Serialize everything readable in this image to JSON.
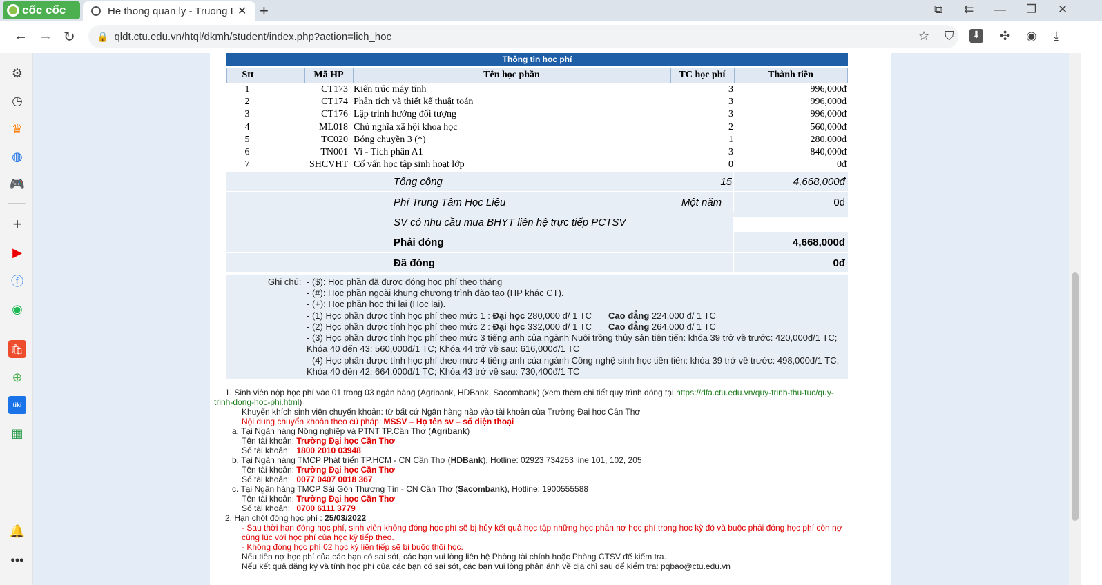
{
  "browser": {
    "logo_text": "cốc cốc",
    "tab_title": "He thong quan ly - Truong D",
    "url": "qldt.ctu.edu.vn/htql/dkmh/student/index.php?action=lich_hoc"
  },
  "fee": {
    "title": "Thông tin học phí",
    "headers": {
      "stt": "Stt",
      "code": "Mã HP",
      "name": "Tên học phần",
      "credits": "TC học phí",
      "amount": "Thành tiền"
    },
    "rows": [
      {
        "stt": "1",
        "code": "CT173",
        "name": "Kiến trúc máy tính",
        "credits": "3",
        "amount": "996,000đ"
      },
      {
        "stt": "2",
        "code": "CT174",
        "name": "Phân tích và thiết kế thuật toán",
        "credits": "3",
        "amount": "996,000đ"
      },
      {
        "stt": "3",
        "code": "CT176",
        "name": "Lập trình hướng đối tượng",
        "credits": "3",
        "amount": "996,000đ"
      },
      {
        "stt": "4",
        "code": "ML018",
        "name": "Chủ nghĩa xã hội khoa học",
        "credits": "2",
        "amount": "560,000đ"
      },
      {
        "stt": "5",
        "code": "TC020",
        "name": "Bóng chuyền 3 (*)",
        "credits": "1",
        "amount": "280,000đ"
      },
      {
        "stt": "6",
        "code": "TN001",
        "name": "Vi - Tích phân A1",
        "credits": "3",
        "amount": "840,000đ"
      },
      {
        "stt": "7",
        "code": "SHCVHT",
        "name": "Cố vấn học tập sinh hoạt lớp",
        "credits": "0",
        "amount": "0đ"
      }
    ],
    "total_label": "Tổng cộng",
    "total_credits": "15",
    "total_amount": "4,668,000đ",
    "material_label": "Phí Trung Tâm Học Liệu",
    "material_period": "Một năm",
    "material_amount": "0đ",
    "insurance_label": "SV có nhu cầu mua BHYT liên hệ trực tiếp PCTSV",
    "must_pay_label": "Phải đóng",
    "must_pay_amount": "4,668,000đ",
    "paid_label": "Đã đóng",
    "paid_amount": "0đ"
  },
  "notes": {
    "label": "Ghi chú:",
    "n1": "- ($): Học phần đã được đóng học phí theo tháng",
    "n2": "- (#): Học phần ngoài khung chương trình đào tạo (HP khác CT).",
    "n3": "- (+): Học phần học thi lại (Học lại).",
    "n4a": "- (1) Học phần được tính học phí theo mức 1 : ",
    "n4b": "Đại học",
    "n4c": " 280,000 đ/ 1 TC",
    "n4d": "Cao đẳng",
    "n4e": " 224,000 đ/ 1 TC",
    "n5a": "- (2) Học phần được tính học phí theo mức 2 : ",
    "n5b": "Đại học",
    "n5c": " 332,000 đ/ 1 TC",
    "n5d": "Cao đẳng",
    "n5e": " 264,000 đ/ 1 TC",
    "n6": "- (3) Học phần được tính học phí theo mức 3 tiếng anh của ngành Nuôi trồng thủy sản tiên tiến: khóa 39 trở về trước: 420,000đ/1 TC; Khóa 40 đến 43: 560,000đ/1 TC; Khóa 44 trở về sau: 616,000đ/1 TC",
    "n7": "- (4) Học phần được tính học phí theo mức 4 tiếng anh của ngành Công nghệ sinh học tiên tiến: khóa 39 trở về trước: 498,000đ/1 TC; Khóa 40 đến 42: 664,000đ/1 TC; Khóa 43 trở về sau: 730,400đ/1 TC"
  },
  "bank": {
    "l1a": "1. Sinh viên nộp học phí vào 01 trong 03 ngân hàng (Agribank, HDBank, Sacombank) (xem thêm chi tiết quy trình đóng tại ",
    "l1link": "https://dfa.ctu.edu.vn/quy-trinh-thu-tuc/quy-",
    "l1link2": "trinh-dong-hoc-phi.html",
    "l1b": ")",
    "l2": "Khuyến khích sinh viên chuyển khoản: từ bất cứ Ngân hàng nào vào tài khoản của Trường Đại học Cần Thơ",
    "l3a": "Nội dung chuyển khoản theo cú pháp: ",
    "l3b": "MSSV – Họ tên sv – số điện thoại",
    "a_a": "a. Tại Ngân hàng Nông nghiệp và PTNT TP.Cần Thơ (",
    "a_b": "Agribank",
    "a_c": ")",
    "acc_name_label": "Tên tài khoản: ",
    "acc_name": "Trường Đại học Cần Thơ",
    "acc_no_label": "Số tài khoản: ",
    "a_no": "1800 2010 03948",
    "b_a": "b. Tại Ngân hàng TMCP Phát triển TP.HCM - CN Cần Thơ (",
    "b_b": "HDBank",
    "b_c": "), Hotline: 02923 734253 line 101, 102, 205",
    "b_no": "0077 0407 0018 367",
    "c_a": "c. Tại Ngân hàng TMCP Sài Gòn Thương Tín - CN Cần Thơ (",
    "c_b": "Sacombank",
    "c_c": "), Hotline: 1900555588",
    "c_no": "0700 6111 3779",
    "d1a": "2. Hạn chót đóng học phí : ",
    "d1b": "25/03/2022",
    "d2": "- Sau thời hạn đóng học phí, sinh viên không đóng học phí sẽ bị hủy kết quả học tập những học phần nợ học phí trong học kỳ đó và buộc phải đóng học phí còn nợ",
    "d3": "cùng lúc với học phí của học kỳ tiếp theo.",
    "d4": "- Không đóng học phí 02 học kỳ liên tiếp sẽ bị buộc thôi học.",
    "d5": "Nếu tiền nợ học phí của các bạn có sai sót, các bạn vui lòng liên hệ Phòng tài chính hoặc Phòng CTSV để kiểm tra.",
    "d6": "Nếu kết quả đăng ký và tính học phí của các bạn có sai sót, các bạn vui lòng phản ánh về địa chỉ sau để kiểm tra: pqbao@ctu.edu.vn"
  }
}
